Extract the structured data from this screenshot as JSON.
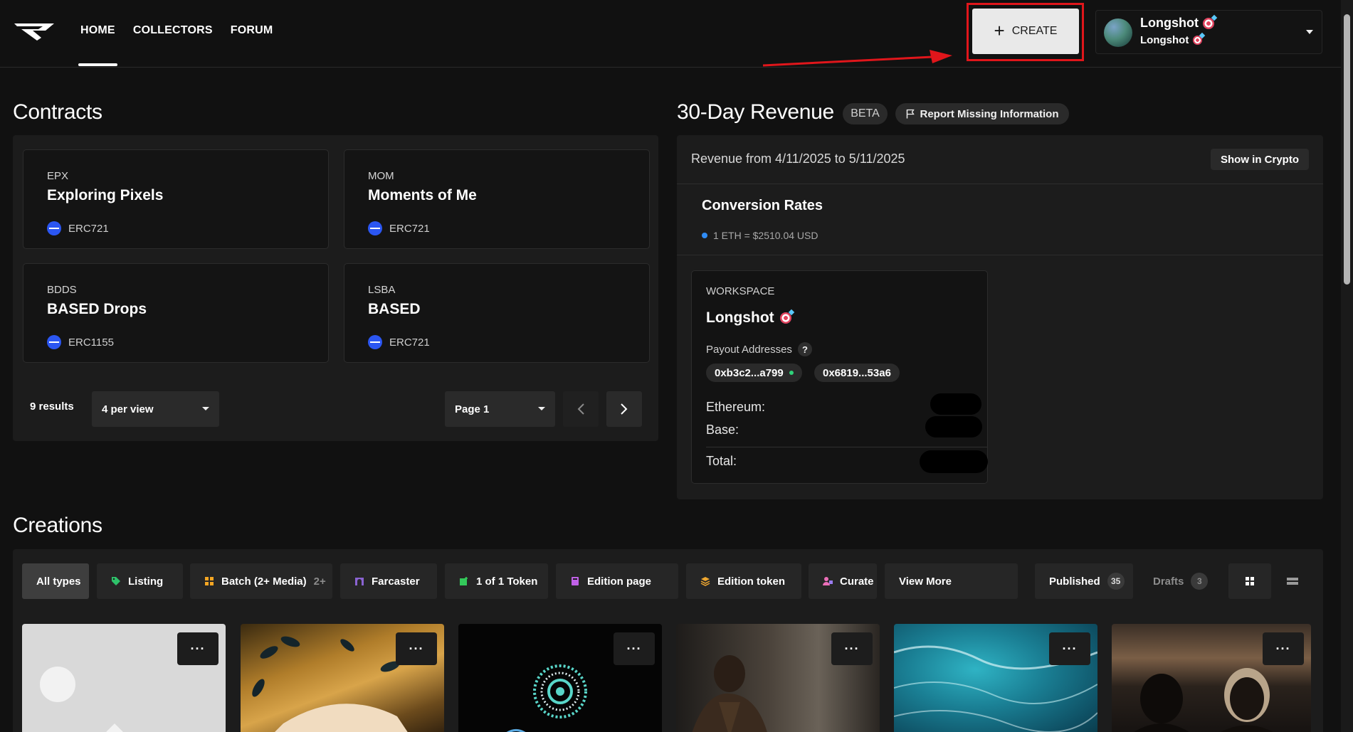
{
  "nav": {
    "items": [
      {
        "label": "HOME",
        "active": true
      },
      {
        "label": "COLLECTORS",
        "active": false
      },
      {
        "label": "FORUM",
        "active": false
      }
    ]
  },
  "create_button": {
    "label": "CREATE",
    "icon": "plus-icon"
  },
  "account": {
    "name": "Longshot",
    "subname": "Longshot",
    "icon": "target-emoji-icon"
  },
  "contracts": {
    "title": "Contracts",
    "cards": [
      {
        "symbol": "EPX",
        "name": "Exploring Pixels",
        "standard": "ERC721"
      },
      {
        "symbol": "MOM",
        "name": "Moments of Me",
        "standard": "ERC721"
      },
      {
        "symbol": "BDDS",
        "name": "BASED Drops",
        "standard": "ERC1155"
      },
      {
        "symbol": "LSBA",
        "name": "BASED",
        "standard": "ERC721"
      }
    ],
    "results": "9 results",
    "per_view": "4 per view",
    "page": "Page 1"
  },
  "revenue": {
    "title": "30-Day Revenue",
    "beta": "BETA",
    "report_label": "Report Missing Information",
    "range": "Revenue from 4/11/2025 to 5/11/2025",
    "show_crypto": "Show in Crypto",
    "conversion_title": "Conversion Rates",
    "conversion_rate": "1 ETH = $2510.04 USD",
    "workspace": {
      "label": "WORKSPACE",
      "name": "Longshot",
      "payout_label": "Payout Addresses",
      "help": "?",
      "addresses": [
        "0xb3c2...a799",
        "0x6819...53a6"
      ],
      "rows": [
        "Ethereum:",
        "Base:",
        "Total:"
      ]
    }
  },
  "creations": {
    "title": "Creations",
    "filters": [
      {
        "label": "All types",
        "icon": "",
        "active": true
      },
      {
        "label": "Listing",
        "icon": "tag-icon"
      },
      {
        "label": "Batch (2+ Media)",
        "icon": "grid-icon",
        "extra": "2+"
      },
      {
        "label": "Farcaster",
        "icon": "arch-icon"
      },
      {
        "label": "1 of 1 Token",
        "icon": "token-icon"
      },
      {
        "label": "Edition page",
        "icon": "edition-page-icon"
      },
      {
        "label": "Edition token",
        "icon": "stack-icon"
      },
      {
        "label": "Curate",
        "icon": "curate-icon"
      },
      {
        "label": "View More",
        "icon": ""
      }
    ],
    "published": {
      "label": "Published",
      "count": "35"
    },
    "drafts": {
      "label": "Drafts",
      "count": "3"
    },
    "more_label": "···"
  },
  "colors": {
    "accent_red": "#e0161b",
    "chain_blue": "#2b56f2",
    "status_green": "#2fd27a"
  }
}
